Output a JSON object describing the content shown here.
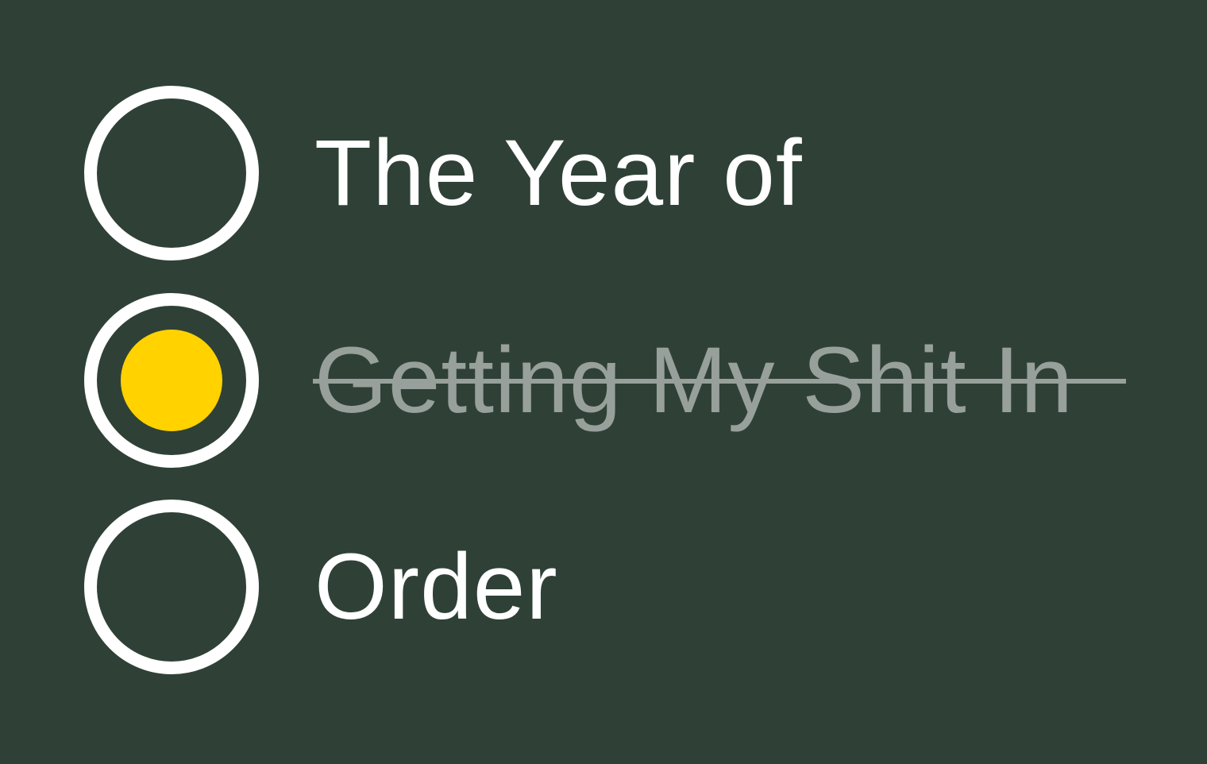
{
  "options": [
    {
      "label": "The Year of",
      "selected": false,
      "struck": false
    },
    {
      "label": "Getting My Shit In",
      "selected": true,
      "struck": true
    },
    {
      "label": "Order",
      "selected": false,
      "struck": false
    }
  ],
  "colors": {
    "background": "#2f4137",
    "ring": "#ffffff",
    "selected_dot": "#ffd200",
    "struck_text": "#98a09b",
    "text": "#ffffff"
  }
}
